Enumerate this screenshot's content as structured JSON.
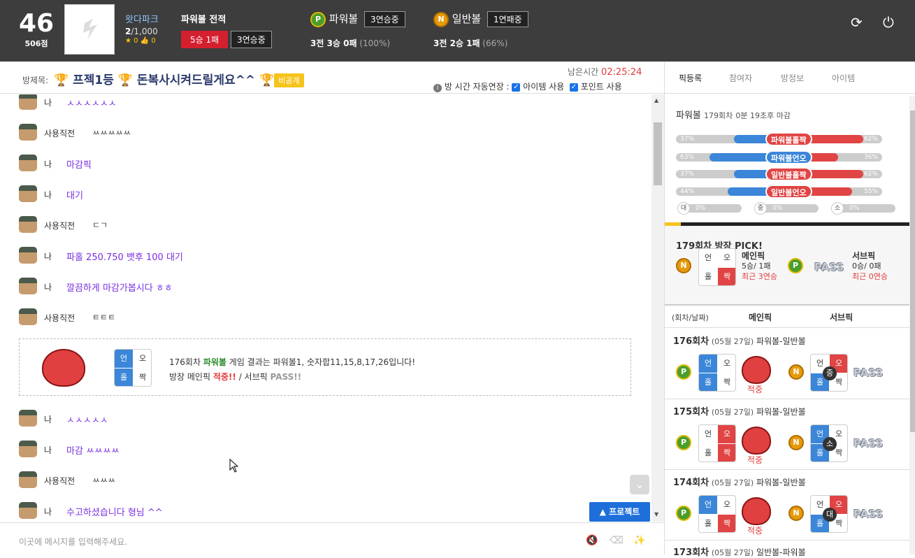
{
  "user": {
    "level": "46",
    "points": "506점",
    "name": "왓다파크",
    "count_cur": "2",
    "count_total": "/1,000",
    "stars": "★ 0  👍 0"
  },
  "record": {
    "title": "파워볼 전적",
    "badge_a": "5승 1패",
    "badge_b": "3연승중"
  },
  "games": [
    {
      "coin": "P",
      "name": "파워볼",
      "streak": "3연승중",
      "summary": "3전 3승 0패",
      "pct": "(100%)"
    },
    {
      "coin": "N",
      "name": "일반볼",
      "streak": "1연패중",
      "summary": "3전 2승 1패",
      "pct": "(66%)"
    }
  ],
  "room": {
    "label": "방제목:",
    "title": "프젝1등",
    "title2": "돈복사시켜드릴게요^^",
    "private": "비공개",
    "remain_label": "남은시간",
    "remain": "02:25:24",
    "auto_label": "방 시간 자동연장 :",
    "opt1": "아이템 사용",
    "opt2": "포인트 사용"
  },
  "chat": [
    {
      "who": "나",
      "text": "ㅅㅅㅅㅅㅅㅅ"
    },
    {
      "who": "사용직전",
      "text": "ㅆㅆㅆㅆㅆ"
    },
    {
      "who": "나",
      "text": "마감픽"
    },
    {
      "who": "나",
      "text": "대기"
    },
    {
      "who": "사용직전",
      "text": "ㄷㄱ"
    },
    {
      "who": "나",
      "text": "파홀 250.750 뱃후 100 대기"
    },
    {
      "who": "나",
      "text": "깔끔하게 마감가봅시다 ㅎㅎ"
    },
    {
      "who": "사용직전",
      "text": "ㅌㅌㅌ"
    },
    {
      "who": "나",
      "text": "ㅅㅅㅅㅅㅅ"
    },
    {
      "who": "나",
      "text": "마감 ㅆㅆㅆㅆ"
    },
    {
      "who": "사용직전",
      "text": "ㅆㅆㅆ"
    },
    {
      "who": "나",
      "text": "수고하셨습니다 형님 ^^"
    }
  ],
  "result": {
    "round": "176회차",
    "game": "파워볼",
    "line1_rest": "게임 결과는 파워볼1, 숫자합11,15,8,17,26입니다!",
    "line2_a": "방장 메인픽",
    "hit": "적중!!",
    "line2_b": "/ 서브픽",
    "pass": "PASS!!"
  },
  "grid": {
    "tl": "언",
    "tr": "오",
    "bl": "홀",
    "br": "짝"
  },
  "input": {
    "placeholder": "이곳에 메시지를 입력해주세요.",
    "project": "▲ 프로젝트"
  },
  "side": {
    "tabs": [
      "픽등록",
      "참여자",
      "방정보",
      "아이템"
    ],
    "round_title": "파워볼",
    "round_no": "179회차",
    "round_time": "0분 19초후 마감",
    "bars": [
      {
        "l": "37%",
        "label": "파워볼홀짝",
        "r": "62%",
        "blue": 37
      },
      {
        "l": "63%",
        "label": "파워볼언오",
        "r": "36%",
        "blue": 63
      },
      {
        "l": "37%",
        "label": "일반볼홀짝",
        "r": "62%",
        "blue": 37
      },
      {
        "l": "44%",
        "label": "일반볼언오",
        "r": "55%",
        "blue": 44
      }
    ],
    "small": [
      {
        "c": "대",
        "v": "0%"
      },
      {
        "c": "중",
        "v": "0%"
      },
      {
        "c": "소",
        "v": "0%"
      }
    ],
    "pick_title": "179회차 방장 PICK!",
    "main_label": "메인픽",
    "main_rec": "5승/ 1패",
    "main_streak": "최근 3연승",
    "sub_label": "서브픽",
    "sub_rec": "0승/ 0패",
    "sub_streak": "최근 0연승",
    "pass": "PASS",
    "hist_head": [
      "(회차/날짜)",
      "메인픽",
      "서브픽"
    ],
    "history": [
      {
        "round": "176회차",
        "date": "(05월 27일)",
        "games": "파워볼-일반볼",
        "hit": "적중",
        "ball": "중"
      },
      {
        "round": "175회차",
        "date": "(05월 27일)",
        "games": "파워볼-일반볼",
        "hit": "적중",
        "ball": "소"
      },
      {
        "round": "174회차",
        "date": "(05월 27일)",
        "games": "파워볼-일반볼",
        "hit": "적중",
        "ball": "대"
      },
      {
        "round": "173회차",
        "date": "(05월 27일)",
        "games": "일반볼-파워볼",
        "hit": "",
        "ball": ""
      }
    ]
  },
  "colors": {
    "blue": "#3b86d8",
    "red": "#e04444",
    "purple": "#7a2fe0",
    "dark": "#3d3d3d"
  }
}
